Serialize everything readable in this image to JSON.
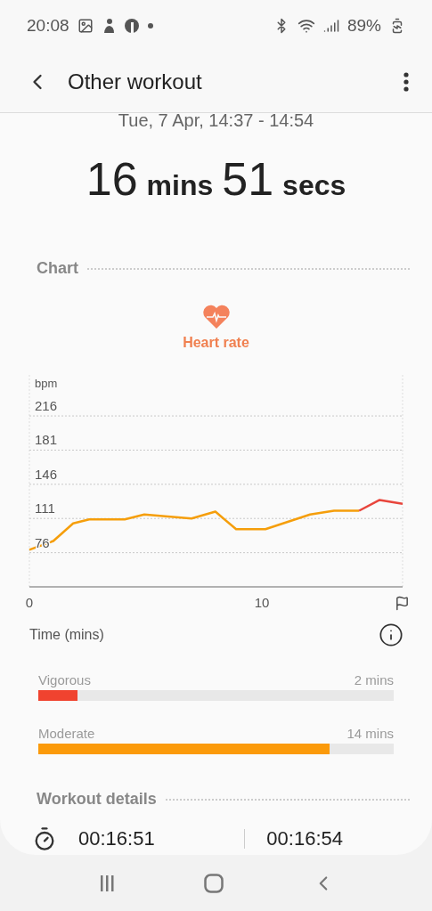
{
  "status_bar": {
    "time": "20:08",
    "battery": "89%"
  },
  "header": {
    "title": "Other workout"
  },
  "summary": {
    "date": "Tue, 7 Apr, 14:37 - 14:54",
    "minutes": "16",
    "minutes_unit": "mins",
    "seconds": "51",
    "seconds_unit": "secs"
  },
  "chart_section": {
    "title": "Chart",
    "metric": "Heart rate",
    "time_label": "Time (mins)",
    "chart_data": {
      "type": "line",
      "ylabel": "bpm",
      "x": [
        0,
        1.03,
        1.88,
        2.57,
        4.1,
        4.94,
        6.97,
        8.0,
        8.89,
        10.15,
        12.07,
        13.1,
        14.18,
        15.06,
        16.05
      ],
      "grid": true,
      "series": [
        {
          "color": "#f59e0b",
          "values": [
            79,
            88,
            106,
            110,
            110,
            115,
            111,
            118,
            100,
            100,
            115,
            119,
            119,
            null,
            null
          ]
        },
        {
          "color": "#e8453c",
          "values": [
            null,
            null,
            null,
            null,
            null,
            null,
            null,
            null,
            null,
            null,
            null,
            null,
            119,
            130,
            126
          ]
        }
      ],
      "xlim": [
        0,
        16.05
      ],
      "ylim": [
        41,
        258
      ],
      "xticks": [
        0,
        10
      ],
      "yticks": [
        76,
        111,
        146,
        181,
        216
      ]
    }
  },
  "zones": [
    {
      "name": "Vigorous",
      "value": "2 mins",
      "color": "#f0432f",
      "level": 0.11
    },
    {
      "name": "Moderate",
      "value": "14 mins",
      "color": "#fb9a0a",
      "level": 0.82
    }
  ],
  "details": {
    "title": "Workout details",
    "duration": "00:16:51",
    "total": "00:16:54"
  }
}
